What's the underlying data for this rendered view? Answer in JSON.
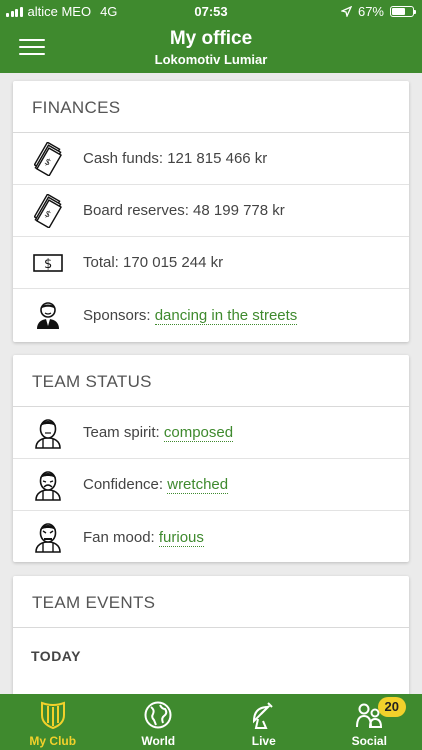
{
  "status_bar": {
    "carrier": "altice MEO",
    "network": "4G",
    "time": "07:53",
    "battery": "67%",
    "battery_level": 0.67
  },
  "header": {
    "title": "My office",
    "subtitle": "Lokomotiv Lumiar"
  },
  "finances": {
    "title": "FINANCES",
    "cash_label": "Cash funds: ",
    "cash_value": "121 815 466 kr",
    "reserves_label": "Board reserves: ",
    "reserves_value": "48 199 778 kr",
    "total_label": "Total: ",
    "total_value": "170 015 244 kr",
    "sponsors_label": "Sponsors: ",
    "sponsors_value": "dancing in the streets"
  },
  "team_status": {
    "title": "TEAM STATUS",
    "spirit_label": "Team spirit: ",
    "spirit_value": "composed",
    "confidence_label": "Confidence: ",
    "confidence_value": "wretched",
    "fan_label": "Fan mood: ",
    "fan_value": "furious"
  },
  "team_events": {
    "title": "TEAM EVENTS",
    "today": "TODAY"
  },
  "tabbar": {
    "my_club": "My Club",
    "world": "World",
    "live": "Live",
    "social": "Social",
    "social_badge": "20"
  },
  "colors": {
    "brand_green": "#3f8a2e",
    "active_yellow": "#f2d12b",
    "link_green": "#3f8a2e"
  }
}
